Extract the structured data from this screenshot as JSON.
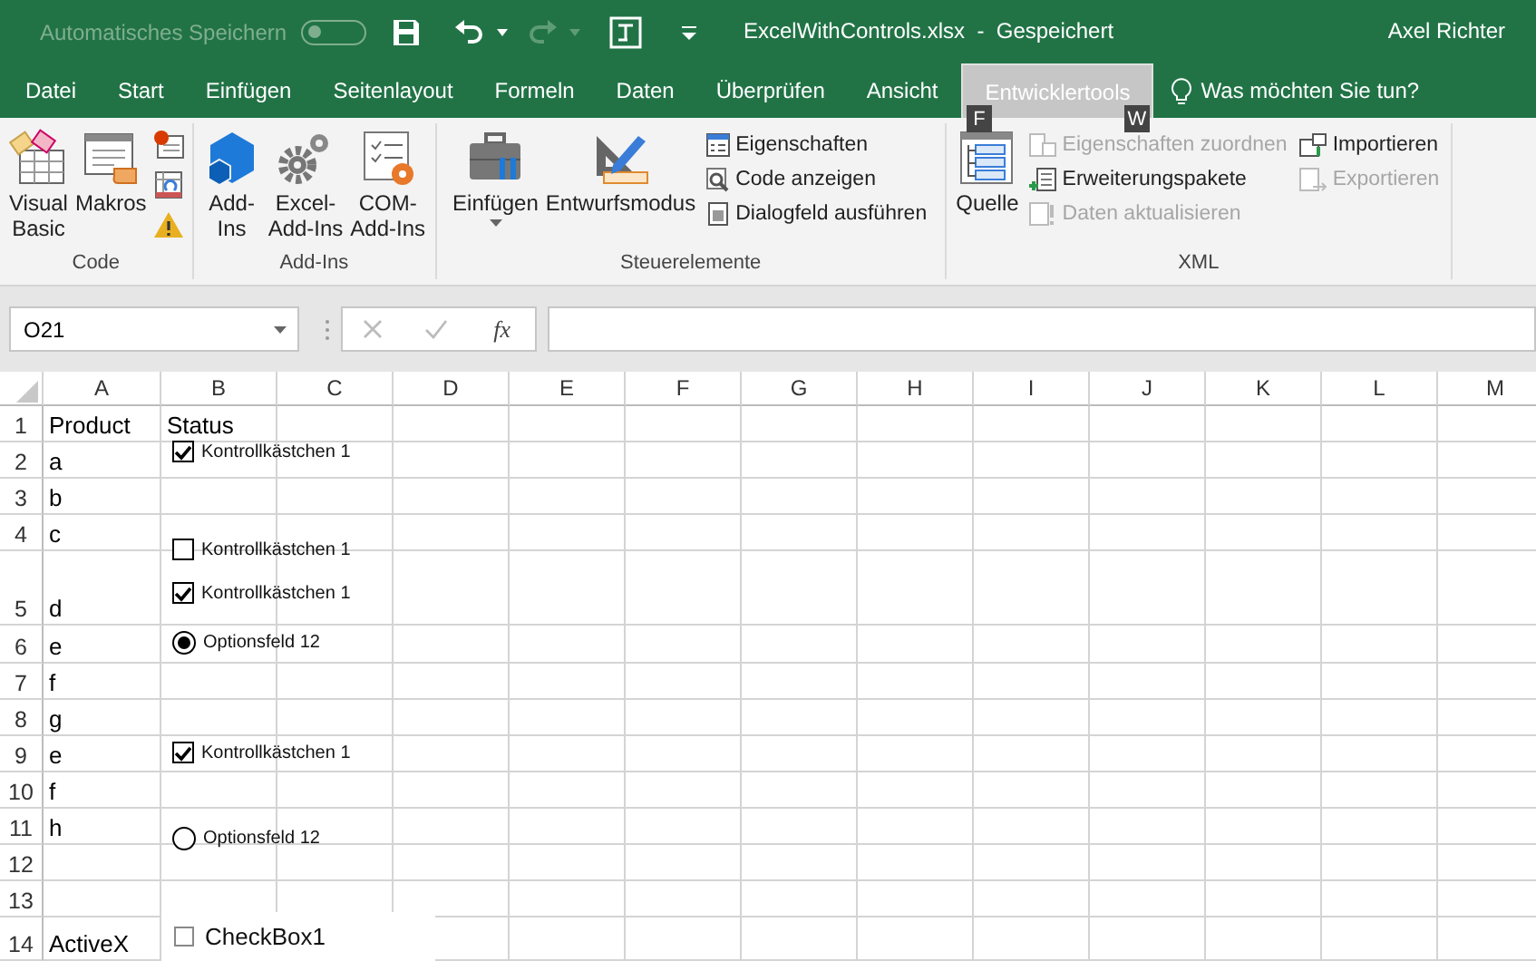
{
  "title_bar": {
    "autosave_label": "Automatisches Speichern",
    "autosave_on": false,
    "file_title": "ExcelWithControls.xlsx  -  Gespeichert",
    "user": "Axel Richter"
  },
  "menu_tabs": [
    {
      "label": "Datei",
      "selected": false
    },
    {
      "label": "Start",
      "selected": false
    },
    {
      "label": "Einfügen",
      "selected": false
    },
    {
      "label": "Seitenlayout",
      "selected": false
    },
    {
      "label": "Formeln",
      "selected": false
    },
    {
      "label": "Daten",
      "selected": false
    },
    {
      "label": "Überprüfen",
      "selected": false
    },
    {
      "label": "Ansicht",
      "selected": false
    },
    {
      "label": "Entwicklertools",
      "selected": true
    }
  ],
  "tell_me": "Was möchten Sie tun?",
  "key_tips": [
    "F",
    "W"
  ],
  "ribbon": [
    {
      "label": "Code",
      "items": [
        {
          "kind": "large",
          "label": "Visual\nBasic"
        },
        {
          "kind": "large",
          "label": "Makros"
        },
        {
          "kind": "icon_column"
        }
      ]
    },
    {
      "label": "Add-Ins",
      "items": [
        {
          "kind": "large",
          "label": "Add-\nIns"
        },
        {
          "kind": "large",
          "label": "Excel-\nAdd-Ins"
        },
        {
          "kind": "large",
          "label": "COM-\nAdd-Ins"
        }
      ]
    },
    {
      "label": "Steuerelemente",
      "items": [
        {
          "kind": "large",
          "label": "Einfügen",
          "dropdown": true
        },
        {
          "kind": "large",
          "label": "Entwurfsmodus"
        },
        {
          "kind": "column",
          "entries": [
            {
              "label": "Eigenschaften",
              "disabled": false
            },
            {
              "label": "Code anzeigen",
              "disabled": false
            },
            {
              "label": "Dialogfeld ausführen",
              "disabled": false
            }
          ]
        }
      ]
    },
    {
      "label": "XML",
      "items": [
        {
          "kind": "large",
          "label": "Quelle"
        },
        {
          "kind": "column",
          "entries": [
            {
              "label": "Eigenschaften zuordnen",
              "disabled": true
            },
            {
              "label": "Erweiterungspakete",
              "disabled": false
            },
            {
              "label": "Daten aktualisieren",
              "disabled": true
            }
          ]
        },
        {
          "kind": "column",
          "entries": [
            {
              "label": "Importieren",
              "disabled": false
            },
            {
              "label": "Exportieren",
              "disabled": true
            }
          ]
        }
      ]
    }
  ],
  "formula_bar": {
    "name_box": "O21",
    "function_button": "fx"
  },
  "columns": [
    "A",
    "B",
    "C",
    "D",
    "E",
    "F",
    "G",
    "H",
    "I",
    "J",
    "K",
    "L",
    "M"
  ],
  "rows": [
    {
      "number": "1",
      "cells": [
        "Product",
        "Status"
      ]
    },
    {
      "number": "2",
      "cells": [
        "a"
      ]
    },
    {
      "number": "3",
      "cells": [
        "b"
      ]
    },
    {
      "number": "4",
      "cells": [
        "c"
      ]
    },
    {
      "number": "5",
      "cells": [
        "d"
      ]
    },
    {
      "number": "6",
      "cells": [
        "e"
      ]
    },
    {
      "number": "7",
      "cells": [
        "f"
      ]
    },
    {
      "number": "8",
      "cells": [
        "g"
      ]
    },
    {
      "number": "9",
      "cells": [
        "e"
      ]
    },
    {
      "number": "10",
      "cells": [
        "f"
      ]
    },
    {
      "number": "11",
      "cells": [
        "h"
      ]
    },
    {
      "number": "12",
      "cells": []
    },
    {
      "number": "13",
      "cells": []
    },
    {
      "number": "14",
      "cells": [
        "ActiveX"
      ]
    }
  ],
  "controls": [
    {
      "kind": "checkbox",
      "label": "Kontrollkästchen 1",
      "checked": true
    },
    {
      "kind": "checkbox",
      "label": "Kontrollkästchen 1",
      "checked": false
    },
    {
      "kind": "checkbox",
      "label": "Kontrollkästchen 1",
      "checked": true
    },
    {
      "kind": "radio",
      "label": "Optionsfeld 12",
      "checked": true
    },
    {
      "kind": "checkbox",
      "label": "Kontrollkästchen 1",
      "checked": true
    },
    {
      "kind": "radio",
      "label": "Optionsfeld 12",
      "checked": false
    },
    {
      "kind": "activex_checkbox",
      "label": "CheckBox1",
      "checked": false
    }
  ]
}
